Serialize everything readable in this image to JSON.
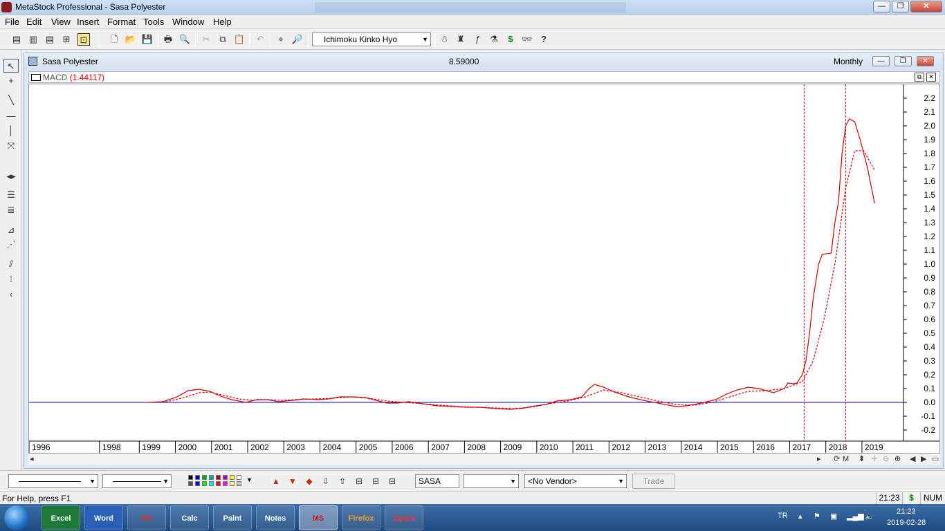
{
  "window": {
    "title": "MetaStock Professional - Sasa Polyester",
    "buttons": {
      "minimize": "—",
      "maximize": "❐",
      "close": "✕"
    }
  },
  "menu": [
    "File",
    "Edit",
    "View",
    "Insert",
    "Format",
    "Tools",
    "Window",
    "Help"
  ],
  "toolbar": {
    "template_combo": "Ichimoku Kinko Hyo",
    "icons": {
      "new": "🗋",
      "open": "📂",
      "save": "💾",
      "print": "🖶",
      "preview": "🔍",
      "cut": "✂",
      "copy": "⧉",
      "paste": "📋",
      "undo": "↶",
      "crosshair": "⌖",
      "zoom": "🔎",
      "dollar": "$",
      "binoculars": "👓",
      "whats_this": "?"
    }
  },
  "chart_window": {
    "name": "Sasa Polyester",
    "price": "8.59000",
    "period": "Monthly",
    "indicator_label": "MACD",
    "indicator_value": "(1.44117)"
  },
  "chart_data": {
    "type": "line",
    "title": "",
    "indicator": "MACD (1.44117)",
    "x_labels": [
      "1996",
      "1998",
      "1999",
      "2000",
      "2001",
      "2002",
      "2003",
      "2004",
      "2005",
      "2006",
      "2007",
      "2008",
      "2009",
      "2010",
      "2011",
      "2012",
      "2013",
      "2014",
      "2015",
      "2016",
      "2017",
      "2018",
      "2019"
    ],
    "y_ticks": [
      2.2,
      2.1,
      2.0,
      1.9,
      1.8,
      1.7,
      1.6,
      1.5,
      1.4,
      1.3,
      1.2,
      1.1,
      1.0,
      0.9,
      0.8,
      0.7,
      0.6,
      0.5,
      0.4,
      0.3,
      0.2,
      0.1,
      0.0,
      -0.1,
      -0.2
    ],
    "y_tick_labels": [
      "2.2",
      "2.1",
      "2.0",
      "1.9",
      "1.8",
      "1.7",
      "1.6",
      "1.5",
      "1.4",
      "1.3",
      "1.2",
      "1.1",
      "1.0",
      "0.9",
      "0.8",
      "0.7",
      "0.6",
      "0.5",
      "0.4",
      "0.3",
      "0.2",
      "0.1",
      "0.0",
      "-0.1",
      "-0.2"
    ],
    "ylim": [
      -0.25,
      2.27
    ],
    "grid": false,
    "baseline": 0.0,
    "vertical_markers": [
      2017.05,
      2018.2
    ],
    "series": [
      {
        "style": "solid",
        "color": "#d00000",
        "points": [
          [
            1998.9,
            0.0
          ],
          [
            1999.3,
            0.005
          ],
          [
            1999.7,
            0.04
          ],
          [
            2000.0,
            0.085
          ],
          [
            2000.3,
            0.095
          ],
          [
            2000.6,
            0.08
          ],
          [
            2000.9,
            0.045
          ],
          [
            2001.2,
            0.02
          ],
          [
            2001.6,
            0.0
          ],
          [
            2001.9,
            0.02
          ],
          [
            2002.2,
            0.02
          ],
          [
            2002.5,
            0.005
          ],
          [
            2002.9,
            0.015
          ],
          [
            2003.2,
            0.025
          ],
          [
            2003.6,
            0.02
          ],
          [
            2003.9,
            0.025
          ],
          [
            2004.2,
            0.04
          ],
          [
            2004.6,
            0.04
          ],
          [
            2004.9,
            0.035
          ],
          [
            2005.2,
            0.015
          ],
          [
            2005.5,
            -0.005
          ],
          [
            2005.8,
            -0.005
          ],
          [
            2006.1,
            0.005
          ],
          [
            2006.5,
            -0.01
          ],
          [
            2006.9,
            -0.025
          ],
          [
            2007.3,
            -0.03
          ],
          [
            2007.7,
            -0.035
          ],
          [
            2008.1,
            -0.035
          ],
          [
            2008.5,
            -0.045
          ],
          [
            2008.9,
            -0.05
          ],
          [
            2009.2,
            -0.045
          ],
          [
            2009.5,
            -0.03
          ],
          [
            2009.9,
            -0.015
          ],
          [
            2010.2,
            0.01
          ],
          [
            2010.6,
            0.02
          ],
          [
            2010.9,
            0.04
          ],
          [
            2011.1,
            0.1
          ],
          [
            2011.25,
            0.13
          ],
          [
            2011.5,
            0.11
          ],
          [
            2011.8,
            0.075
          ],
          [
            2012.2,
            0.04
          ],
          [
            2012.6,
            0.015
          ],
          [
            2012.9,
            0.0
          ],
          [
            2013.2,
            -0.015
          ],
          [
            2013.5,
            -0.03
          ],
          [
            2013.8,
            -0.025
          ],
          [
            2014.2,
            -0.005
          ],
          [
            2014.6,
            0.02
          ],
          [
            2014.9,
            0.06
          ],
          [
            2015.2,
            0.09
          ],
          [
            2015.5,
            0.11
          ],
          [
            2015.8,
            0.1
          ],
          [
            2016.2,
            0.07
          ],
          [
            2016.5,
            0.1
          ],
          [
            2016.6,
            0.14
          ],
          [
            2016.75,
            0.135
          ],
          [
            2016.85,
            0.14
          ],
          [
            2017.0,
            0.2
          ],
          [
            2017.1,
            0.3
          ],
          [
            2017.2,
            0.5
          ],
          [
            2017.3,
            0.75
          ],
          [
            2017.45,
            1.0
          ],
          [
            2017.55,
            1.07
          ],
          [
            2017.8,
            1.08
          ],
          [
            2017.9,
            1.3
          ],
          [
            2018.0,
            1.45
          ],
          [
            2018.1,
            1.8
          ],
          [
            2018.2,
            2.0
          ],
          [
            2018.3,
            2.05
          ],
          [
            2018.45,
            2.03
          ],
          [
            2018.6,
            1.9
          ],
          [
            2018.8,
            1.7
          ],
          [
            2019.0,
            1.44
          ]
        ]
      },
      {
        "style": "dashed",
        "color": "#d00000",
        "points": [
          [
            1998.9,
            0.0
          ],
          [
            1999.4,
            0.005
          ],
          [
            1999.9,
            0.035
          ],
          [
            2000.3,
            0.07
          ],
          [
            2000.6,
            0.075
          ],
          [
            2001.0,
            0.05
          ],
          [
            2001.4,
            0.025
          ],
          [
            2001.8,
            0.015
          ],
          [
            2002.2,
            0.02
          ],
          [
            2002.6,
            0.015
          ],
          [
            2003.0,
            0.02
          ],
          [
            2003.5,
            0.025
          ],
          [
            2004.0,
            0.03
          ],
          [
            2004.5,
            0.04
          ],
          [
            2005.0,
            0.03
          ],
          [
            2005.5,
            0.01
          ],
          [
            2006.0,
            0.0
          ],
          [
            2006.5,
            -0.01
          ],
          [
            2007.0,
            -0.02
          ],
          [
            2007.5,
            -0.03
          ],
          [
            2008.0,
            -0.035
          ],
          [
            2008.5,
            -0.04
          ],
          [
            2009.0,
            -0.045
          ],
          [
            2009.5,
            -0.035
          ],
          [
            2010.0,
            -0.01
          ],
          [
            2010.5,
            0.01
          ],
          [
            2011.0,
            0.04
          ],
          [
            2011.5,
            0.09
          ],
          [
            2012.0,
            0.07
          ],
          [
            2012.5,
            0.04
          ],
          [
            2013.0,
            0.01
          ],
          [
            2013.5,
            -0.015
          ],
          [
            2014.0,
            -0.02
          ],
          [
            2014.5,
            0.0
          ],
          [
            2015.0,
            0.04
          ],
          [
            2015.5,
            0.08
          ],
          [
            2016.0,
            0.085
          ],
          [
            2016.5,
            0.1
          ],
          [
            2017.0,
            0.15
          ],
          [
            2017.3,
            0.3
          ],
          [
            2017.6,
            0.6
          ],
          [
            2017.9,
            1.0
          ],
          [
            2018.2,
            1.55
          ],
          [
            2018.45,
            1.82
          ],
          [
            2018.7,
            1.82
          ],
          [
            2019.0,
            1.68
          ]
        ]
      }
    ],
    "x_range": [
      1995.6,
      2019.8
    ]
  },
  "bottom_toolbar": {
    "symbol": "SASA",
    "vendor": "<No Vendor>",
    "trade": "Trade",
    "swatches": [
      "#000000",
      "#0000aa",
      "#00aa00",
      "#00aaaa",
      "#aa0000",
      "#aa00aa",
      "#ffff00",
      "#ffffff",
      "#555555",
      "#0000ff",
      "#00ff00",
      "#00ffff",
      "#ff0000",
      "#ff00ff",
      "#ffff80",
      "#c0c0c0"
    ]
  },
  "status": {
    "help": "For Help, press F1",
    "time": "21:23",
    "dollar": "$",
    "num": "NUM"
  },
  "taskbar": {
    "lang": "TR",
    "clock_time": "21:23",
    "clock_date": "2019-02-28",
    "apps": [
      "Excel",
      "Word",
      "MS",
      "Calc",
      "Paint",
      "Notes",
      "MS",
      "Firefox",
      "Opera"
    ]
  }
}
